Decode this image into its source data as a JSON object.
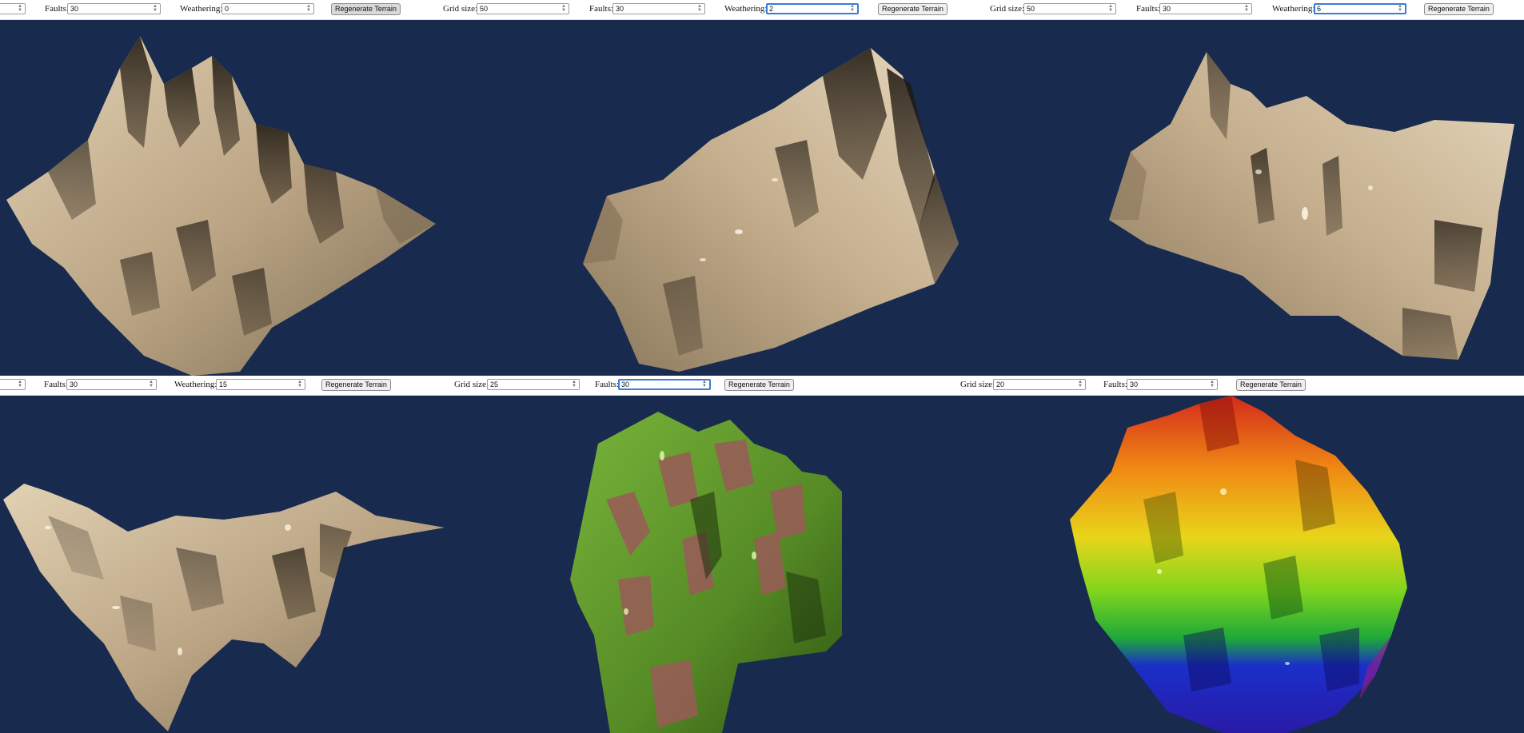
{
  "controls": {
    "grid_size_label": "Grid size:",
    "faults_label": "Faults:",
    "weathering_label": "Weathering:",
    "regenerate_label": "Regenerate Terrain",
    "spinner_icon": "spinner-arrows-icon"
  },
  "colors": {
    "scene_background": "#182a4e",
    "terrain_sand": "#cdb89a",
    "terrain_green": "#5f9a2c",
    "terrain_maroon": "#9a5a58"
  },
  "panels": [
    {
      "name": "panel-top-left",
      "faults": "30",
      "weathering": "0"
    },
    {
      "name": "panel-top-middle",
      "grid_size": "50",
      "faults": "30",
      "weathering": "2"
    },
    {
      "name": "panel-top-right",
      "grid_size": "50",
      "faults": "30",
      "weathering": "6"
    },
    {
      "name": "panel-bottom-left",
      "faults": "30",
      "weathering": "15"
    },
    {
      "name": "panel-bottom-middle",
      "grid_size": "25",
      "faults": "30"
    },
    {
      "name": "panel-bottom-right",
      "grid_size": "20",
      "faults": "30"
    }
  ]
}
